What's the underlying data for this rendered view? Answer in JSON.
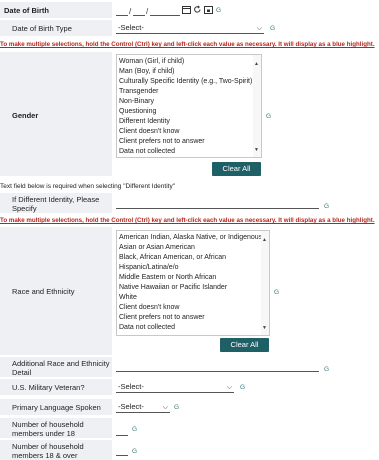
{
  "dob": {
    "label": "Date of Birth",
    "sep1": "/",
    "sep2": "/",
    "g": "G",
    "icons": [
      "calendar-icon",
      "reset-icon",
      "calendar-today-icon"
    ]
  },
  "dob_type": {
    "label": "Date of Birth Type",
    "value": "-Select-",
    "g": "G"
  },
  "multi_warning_1": "To make multiple selections, hold the Control (Ctrl) key and left-click each value as necessary. It will display as a blue highlight.",
  "gender": {
    "label": "Gender",
    "options": [
      "Woman (Girl, if child)",
      "Man (Boy, if child)",
      "Culturally Specific Identity (e.g., Two-Spirit)",
      "Transgender",
      "Non-Binary",
      "Questioning",
      "Different Identity",
      "Client doesn't know",
      "Client prefers not to answer",
      "Data not collected"
    ],
    "clear_label": "Clear All",
    "g": "G"
  },
  "different_identity_note": "Text field below is required when selecting \"Different Identity\"",
  "diff_identity": {
    "label_line1": "If Different Identity, Please",
    "label_line2": "Specify",
    "g": "G"
  },
  "multi_warning_2": "To make multiple selections, hold the Control (Ctrl) key and left-click each value as necessary. It will display as a blue highlight.",
  "race": {
    "label": "Race and Ethnicity",
    "options": [
      "American Indian, Alaska Native, or Indigenous",
      "Asian or Asian American",
      "Black, African American, or African",
      "Hispanic/Latina/e/o",
      "Middle Eastern or North African",
      "Native Hawaiian or Pacific Islander",
      "White",
      "Client doesn't know",
      "Client prefers not to answer",
      "Data not collected"
    ],
    "clear_label": "Clear All",
    "g": "G"
  },
  "add_race": {
    "label_line1": "Additional Race and Ethnicity",
    "label_line2": "Detail",
    "g": "G"
  },
  "veteran": {
    "label": "U.S. Military Veteran?",
    "value": "-Select-",
    "g": "G"
  },
  "language": {
    "label": "Primary Language Spoken",
    "value": "-Select-",
    "g": "G"
  },
  "under18": {
    "label_line1": "Number of household",
    "label_line2": "members under 18",
    "g": "G"
  },
  "over18": {
    "label_line1": "Number of household",
    "label_line2": "members 18 & over",
    "g": "G"
  }
}
